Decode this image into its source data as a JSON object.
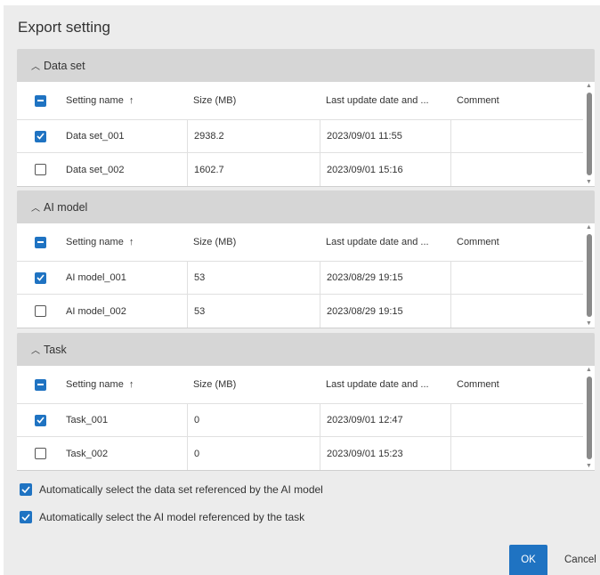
{
  "dialog": {
    "title": "Export setting",
    "ok_label": "OK",
    "cancel_label": "Cancel"
  },
  "columns": {
    "name": "Setting name",
    "sort_arrow": "↑",
    "size": "Size (MB)",
    "date": "Last update date and ...",
    "comment": "Comment"
  },
  "sections": [
    {
      "title": "Data set",
      "rows": [
        {
          "name": "Data set_001",
          "size": "2938.2",
          "date": "2023/09/01 11:55",
          "comment": "",
          "checked": true
        },
        {
          "name": "Data set_002",
          "size": "1602.7",
          "date": "2023/09/01 15:16",
          "comment": "",
          "checked": false
        }
      ]
    },
    {
      "title": "AI model",
      "rows": [
        {
          "name": "AI model_001",
          "size": "53",
          "date": "2023/08/29 19:15",
          "comment": "",
          "checked": true
        },
        {
          "name": "AI model_002",
          "size": "53",
          "date": "2023/08/29 19:15",
          "comment": "",
          "checked": false
        }
      ]
    },
    {
      "title": "Task",
      "rows": [
        {
          "name": "Task_001",
          "size": "0",
          "date": "2023/09/01 12:47",
          "comment": "",
          "checked": true
        },
        {
          "name": "Task_002",
          "size": "0",
          "date": "2023/09/01 15:23",
          "comment": "",
          "checked": false
        }
      ]
    }
  ],
  "options": [
    {
      "label": "Automatically select the data set referenced by the AI model",
      "checked": true
    },
    {
      "label": "Automatically select the AI model referenced by the task",
      "checked": true
    }
  ],
  "colors": {
    "accent": "#1f73c2",
    "section_header": "#d6d6d6",
    "dialog_bg": "#ececec"
  }
}
